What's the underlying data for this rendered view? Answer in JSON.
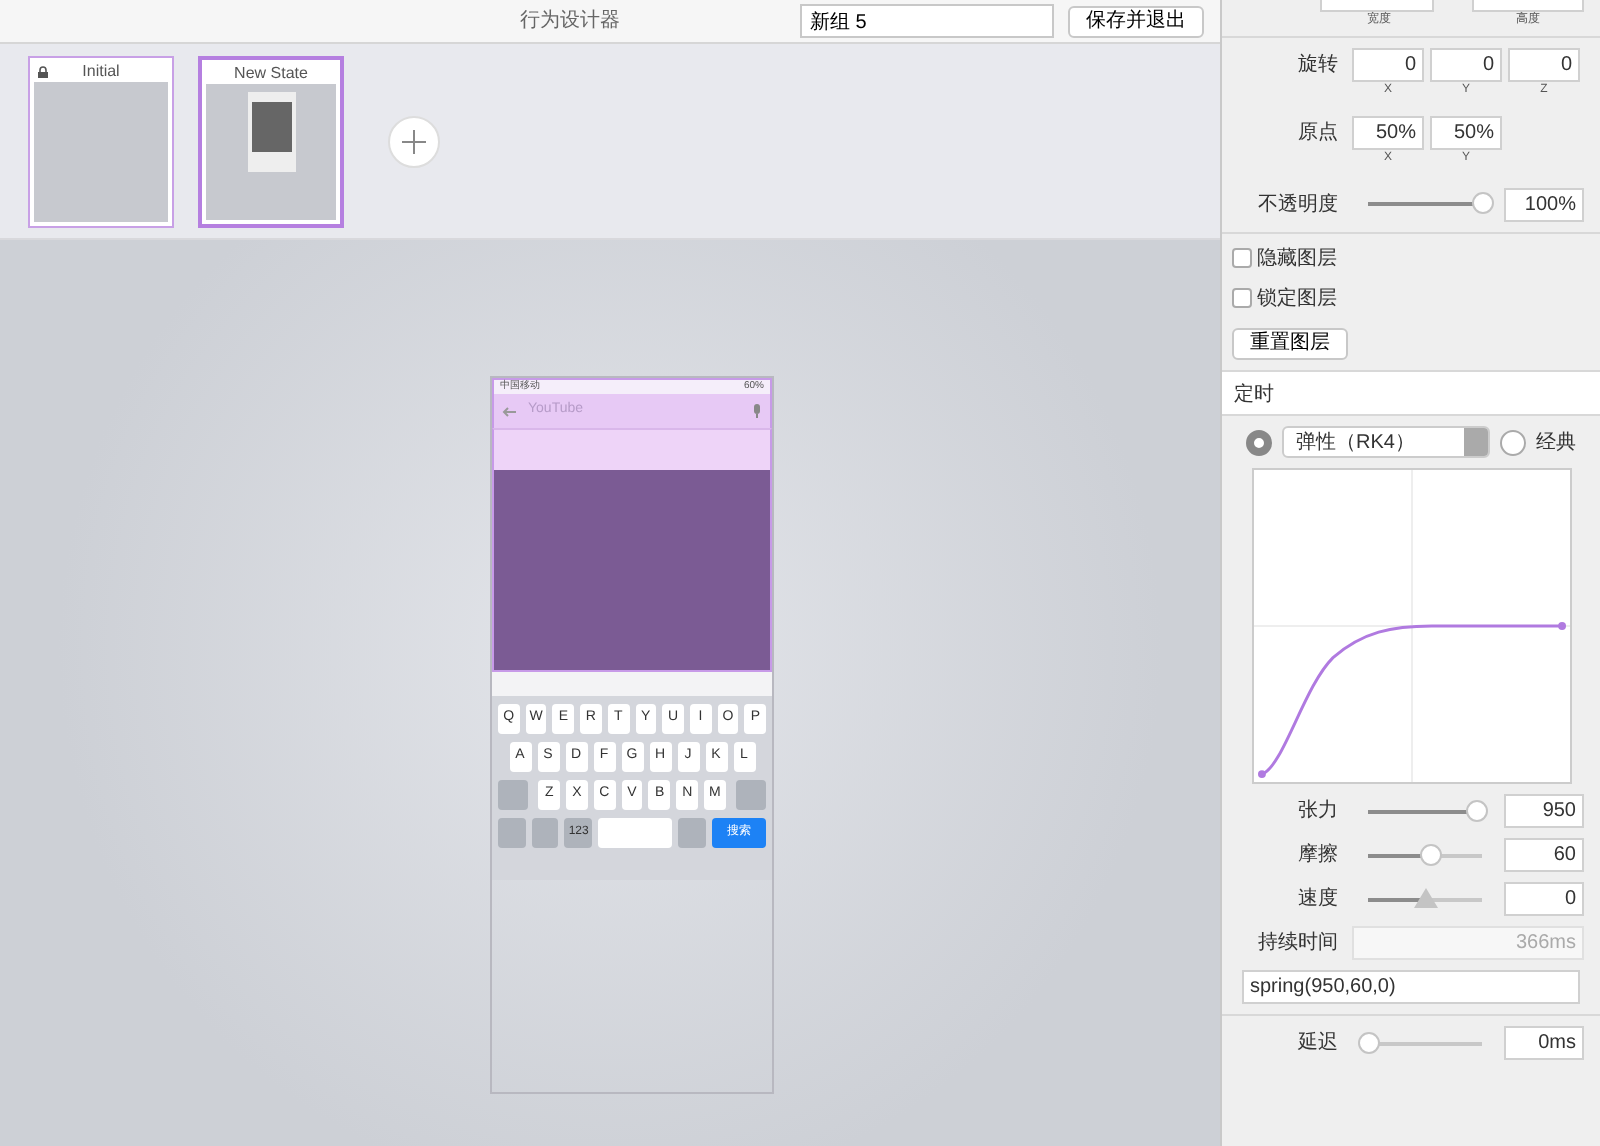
{
  "toolbar": {
    "title": "行为设计器",
    "group_name": "新组 5",
    "save_button": "保存并退出"
  },
  "states": [
    {
      "label": "Initial",
      "locked": true,
      "selected": false
    },
    {
      "label": "New State",
      "locked": false,
      "selected": true
    }
  ],
  "phone": {
    "carrier": "中国移动",
    "battery": "60%",
    "search_placeholder": "YouTube",
    "keyboard_rows": [
      [
        "Q",
        "W",
        "E",
        "R",
        "T",
        "Y",
        "U",
        "I",
        "O",
        "P"
      ],
      [
        "A",
        "S",
        "D",
        "F",
        "G",
        "H",
        "J",
        "K",
        "L"
      ],
      [
        "Z",
        "X",
        "C",
        "V",
        "B",
        "N",
        "M"
      ]
    ],
    "numbers_key": "123",
    "search_key": "搜索"
  },
  "properties": {
    "size_labels": [
      "宽度",
      "高度"
    ],
    "rotation": {
      "label": "旋转",
      "fields": [
        {
          "value": "0",
          "axis": "X"
        },
        {
          "value": "0",
          "axis": "Y"
        },
        {
          "value": "0",
          "axis": "Z"
        }
      ]
    },
    "origin": {
      "label": "原点",
      "fields": [
        {
          "value": "50%",
          "axis": "X"
        },
        {
          "value": "50%",
          "axis": "Y"
        }
      ]
    },
    "opacity": {
      "label": "不透明度",
      "level": 1,
      "value": "100%"
    }
  },
  "layer_options": [
    {
      "label": "隐藏图层",
      "checked": false
    },
    {
      "label": "锁定图层",
      "checked": false
    }
  ],
  "reset_button": "重置图层",
  "timing": {
    "title": "定时",
    "modes": [
      {
        "kind": "select",
        "label": "弹性（RK4）",
        "selected": true
      },
      {
        "kind": "radio",
        "label": "经典",
        "selected": false
      }
    ],
    "params": [
      {
        "kind": "slider",
        "label": "张力",
        "level": 0.95,
        "value": "950"
      },
      {
        "kind": "slider",
        "label": "摩擦",
        "level": 0.55,
        "value": "60"
      },
      {
        "kind": "pointer",
        "label": "速度",
        "level": 0.5,
        "value": "0"
      },
      {
        "kind": "readout",
        "label": "持续时间",
        "value": "366ms"
      }
    ],
    "expression": "spring(950,60,0)",
    "delay": {
      "label": "延迟",
      "level": 0,
      "value": "0ms"
    }
  }
}
